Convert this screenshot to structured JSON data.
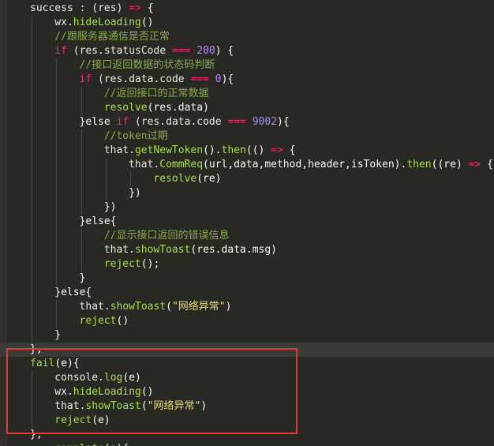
{
  "code": {
    "lines": [
      [
        "success : ",
        "(res) ",
        "=> ",
        "{"
      ],
      [
        "wx.",
        "hideLoading",
        "()"
      ],
      [
        "//跟服务器通信是否正常"
      ],
      [
        "if ",
        "(res.statusCode ",
        "=== ",
        "200",
        ") {"
      ],
      [
        "//接口返回数据的状态码判断"
      ],
      [
        "if ",
        "(res.data.code ",
        "=== ",
        "0",
        "){"
      ],
      [
        "//返回接口的正常数据"
      ],
      [
        "resolve",
        "(res.data)"
      ],
      [
        "}else ",
        "if ",
        "(res.data.code ",
        "=== ",
        "9002",
        "){"
      ],
      [
        "//token过期"
      ],
      [
        "that.",
        "getNewToken",
        "().",
        "then",
        "(() ",
        "=> ",
        "{"
      ],
      [
        "that.",
        "CommReq",
        "(url,data,method,header,isToken).",
        "then",
        "((re) ",
        "=> ",
        "{"
      ],
      [
        "resolve",
        "(re)"
      ],
      [
        "})"
      ],
      [
        "})"
      ],
      [
        "}else{"
      ],
      [
        "//显示接口返回的错误信息"
      ],
      [
        "that.",
        "showToast",
        "(res.data.msg)"
      ],
      [
        "reject",
        "();"
      ],
      [
        "}"
      ],
      [
        "}else{"
      ],
      [
        "that.",
        "showToast",
        "(",
        "\"网络异常\"",
        ")"
      ],
      [
        "reject",
        "()"
      ],
      [
        "}"
      ],
      [
        "},"
      ],
      [
        "fail",
        "(e){"
      ],
      [
        "console.",
        "log",
        "(e)"
      ],
      [
        "wx.",
        "hideLoading",
        "()"
      ],
      [
        "that.",
        "showToast",
        "(",
        "\"网络异常\"",
        ")"
      ],
      [
        "reject",
        "(e)"
      ],
      [
        "},"
      ],
      [
        "complete",
        "(e){"
      ]
    ]
  }
}
